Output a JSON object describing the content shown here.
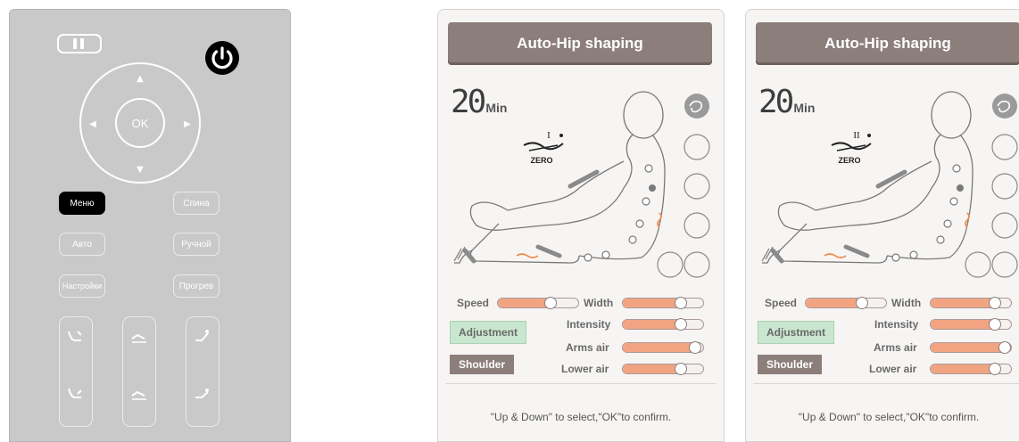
{
  "remote": {
    "menu_label": "Меню",
    "back_label": "Спина",
    "auto_label": "Авто",
    "manual_label": "Ручной",
    "settings_label": "Настройки",
    "heat_label": "Прогрев",
    "ok_label": "OK",
    "up_glyph": "▲",
    "down_glyph": "▼",
    "left_glyph": "◀",
    "right_glyph": "▶"
  },
  "panels": [
    {
      "title": "Auto-Hip shaping",
      "timer_value": "20",
      "timer_unit": "Min",
      "mode_numeral": "I",
      "mode_label": "ZERO",
      "controls": {
        "speed_label": "Speed",
        "width_label": "Width",
        "intensity_label": "Intensity",
        "arms_air_label": "Arms air",
        "lower_air_label": "Lower air",
        "speed_level": 0.65,
        "width_level": 0.72,
        "intensity_level": 0.72,
        "arms_air_level": 0.9,
        "lower_air_level": 0.72
      },
      "adjustment_label": "Adjustment",
      "shoulder_label": "Shoulder",
      "hint": "\"Up & Down\" to select,\"OK\"to confirm."
    },
    {
      "title": "Auto-Hip shaping",
      "timer_value": "20",
      "timer_unit": "Min",
      "mode_numeral": "II",
      "mode_label": "ZERO",
      "controls": {
        "speed_label": "Speed",
        "width_label": "Width",
        "intensity_label": "Intensity",
        "arms_air_label": "Arms air",
        "lower_air_label": "Lower air",
        "speed_level": 0.7,
        "width_level": 0.8,
        "intensity_level": 0.8,
        "arms_air_level": 0.92,
        "lower_air_level": 0.8
      },
      "adjustment_label": "Adjustment",
      "shoulder_label": "Shoulder",
      "hint": "\"Up & Down\" to select,\"OK\"to confirm."
    }
  ],
  "colors": {
    "remote_bg": "#c9c9c9",
    "title_bar": "#8c7e7b",
    "slider_fill": "#f2a482",
    "adjustment_bg": "#c9e6cf",
    "accent_orange": "#f08a4b"
  }
}
